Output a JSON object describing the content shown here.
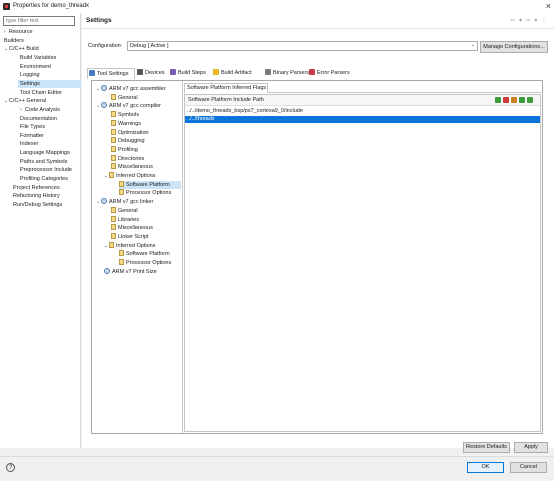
{
  "window": {
    "title": "Properties for demo_threadx"
  },
  "left_nav": {
    "filter_placeholder": "type filter text",
    "items": [
      {
        "label": "Resource",
        "arrow": "›"
      },
      {
        "label": "Builders",
        "arrow": ""
      },
      {
        "label": "C/C++ Build",
        "arrow": "⌄"
      },
      {
        "label": "Build Variables",
        "arrow": ""
      },
      {
        "label": "Environment",
        "arrow": ""
      },
      {
        "label": "Logging",
        "arrow": ""
      },
      {
        "label": "Settings",
        "arrow": ""
      },
      {
        "label": "Tool Chain Editor",
        "arrow": ""
      },
      {
        "label": "C/C++ General",
        "arrow": "⌄"
      },
      {
        "label": "Code Analysis",
        "arrow": "›"
      },
      {
        "label": "Documentation",
        "arrow": ""
      },
      {
        "label": "File Types",
        "arrow": ""
      },
      {
        "label": "Formatter",
        "arrow": ""
      },
      {
        "label": "Indexer",
        "arrow": ""
      },
      {
        "label": "Language Mappings",
        "arrow": ""
      },
      {
        "label": "Paths and Symbols",
        "arrow": ""
      },
      {
        "label": "Preprocessor Include",
        "arrow": ""
      },
      {
        "label": "Profiling Categories",
        "arrow": ""
      },
      {
        "label": "Project References",
        "arrow": ""
      },
      {
        "label": "Refactoring History",
        "arrow": ""
      },
      {
        "label": "Run/Debug Settings",
        "arrow": ""
      }
    ]
  },
  "settings": {
    "title": "Settings",
    "nav_icons": "⇦ ▾ ⇨ ▾ ⋮",
    "configuration_label": "Configuration:",
    "configuration_value": "Debug  [ Active ]",
    "manage_button": "Manage Configurations..."
  },
  "tabs": [
    {
      "label": "Tool Settings",
      "color": "#4a7cc2"
    },
    {
      "label": "Devices",
      "color": "#555555"
    },
    {
      "label": "Build Steps",
      "color": "#7a5fb0"
    },
    {
      "label": "Build Artifact",
      "color": "#e8b622"
    },
    {
      "label": "Binary Parsers",
      "color": "#7a7a7a"
    },
    {
      "label": "Error Parsers",
      "color": "#d23b3b"
    }
  ],
  "tool_tree": [
    {
      "label": "ARM v7 gcc assembler",
      "arrow": "⌄",
      "icon": "gear"
    },
    {
      "label": "General",
      "arrow": "",
      "icon": "leaf"
    },
    {
      "label": "ARM v7 gcc compiler",
      "arrow": "⌄",
      "icon": "gear"
    },
    {
      "label": "Symbols",
      "arrow": "",
      "icon": "leaf"
    },
    {
      "label": "Warnings",
      "arrow": "",
      "icon": "leaf"
    },
    {
      "label": "Optimization",
      "arrow": "",
      "icon": "leaf"
    },
    {
      "label": "Debugging",
      "arrow": "",
      "icon": "leaf"
    },
    {
      "label": "Profiling",
      "arrow": "",
      "icon": "leaf"
    },
    {
      "label": "Directories",
      "arrow": "",
      "icon": "leaf"
    },
    {
      "label": "Miscellaneous",
      "arrow": "",
      "icon": "leaf"
    },
    {
      "label": "Inferred Options",
      "arrow": "⌄",
      "icon": "leaf"
    },
    {
      "label": "Software Platform",
      "arrow": "",
      "icon": "leaf"
    },
    {
      "label": "Processor Options",
      "arrow": "",
      "icon": "leaf"
    },
    {
      "label": "ARM v7 gcc linker",
      "arrow": "⌄",
      "icon": "gear"
    },
    {
      "label": "General",
      "arrow": "",
      "icon": "leaf"
    },
    {
      "label": "Libraries",
      "arrow": "",
      "icon": "leaf"
    },
    {
      "label": "Miscellaneous",
      "arrow": "",
      "icon": "leaf"
    },
    {
      "label": "Linker Script",
      "arrow": "",
      "icon": "leaf"
    },
    {
      "label": "Inferred Options",
      "arrow": "⌄",
      "icon": "leaf"
    },
    {
      "label": "Software Platform",
      "arrow": "",
      "icon": "leaf"
    },
    {
      "label": "Processor Options",
      "arrow": "",
      "icon": "leaf"
    },
    {
      "label": "ARM v7 Print Size",
      "arrow": "",
      "icon": "gear"
    }
  ],
  "software_platform": {
    "sub_tab": "Software Platform Inferred Flags",
    "panel_title": "Software Platform Include Path",
    "paths": [
      "../../demo_threadx_bsp/ps7_cortexa9_0/include",
      "../../threadx"
    ],
    "toolbar_icons": [
      {
        "name": "add-include-icon",
        "color": "#3d9a3d"
      },
      {
        "name": "delete-include-icon",
        "color": "#d23b3b"
      },
      {
        "name": "edit-include-icon",
        "color": "#c9801e"
      },
      {
        "name": "move-up-icon",
        "color": "#3d9a3d"
      },
      {
        "name": "move-down-icon",
        "color": "#3d9a3d"
      }
    ]
  },
  "footer": {
    "restore_button": "Restore Defaults",
    "apply_button": "Apply",
    "help_icon": "?",
    "ok_button": "OK",
    "cancel_button": "Cancel"
  }
}
